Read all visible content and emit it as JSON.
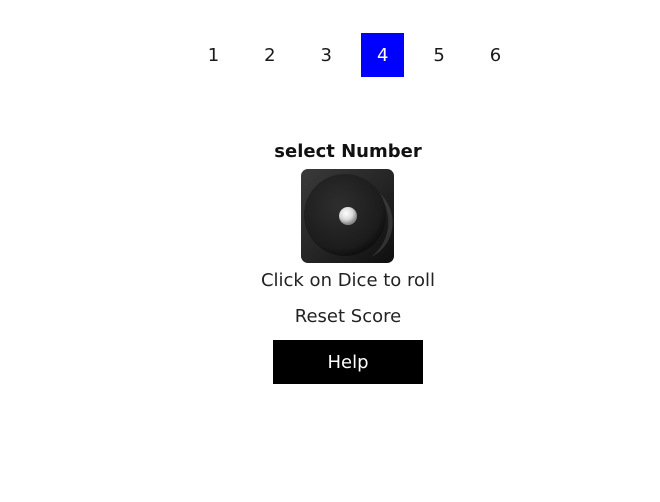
{
  "number_selector": {
    "options": [
      "1",
      "2",
      "3",
      "4",
      "5",
      "6"
    ],
    "selected": "4",
    "selected_color": "#0000ff"
  },
  "select_label": "select Number",
  "dice": {
    "icon": "dice-face-one-icon",
    "face_value": 1
  },
  "roll_instruction": "Click on Dice to roll",
  "reset_label": "Reset Score",
  "help_label": "Help"
}
